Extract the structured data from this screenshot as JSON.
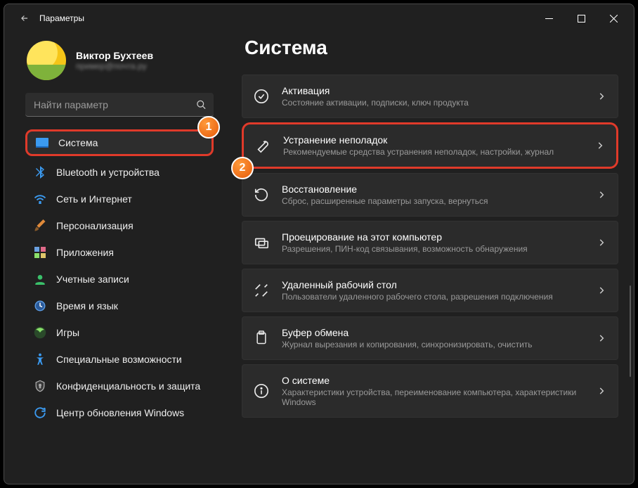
{
  "window": {
    "title": "Параметры"
  },
  "profile": {
    "name": "Виктор Бухтеев",
    "subtitle": "пример@почта.ру"
  },
  "search": {
    "placeholder": "Найти параметр"
  },
  "sidebar": {
    "items": [
      {
        "label": "Система"
      },
      {
        "label": "Bluetooth и устройства"
      },
      {
        "label": "Сеть и Интернет"
      },
      {
        "label": "Персонализация"
      },
      {
        "label": "Приложения"
      },
      {
        "label": "Учетные записи"
      },
      {
        "label": "Время и язык"
      },
      {
        "label": "Игры"
      },
      {
        "label": "Специальные возможности"
      },
      {
        "label": "Конфиденциальность и защита"
      },
      {
        "label": "Центр обновления Windows"
      }
    ]
  },
  "page": {
    "title": "Система"
  },
  "cards": [
    {
      "title": "Активация",
      "subtitle": "Состояние активации, подписки, ключ продукта"
    },
    {
      "title": "Устранение неполадок",
      "subtitle": "Рекомендуемые средства устранения неполадок, настройки, журнал"
    },
    {
      "title": "Восстановление",
      "subtitle": "Сброс, расширенные параметры запуска, вернуться"
    },
    {
      "title": "Проецирование на этот компьютер",
      "subtitle": "Разрешения, ПИН-код связывания, возможность обнаружения"
    },
    {
      "title": "Удаленный рабочий стол",
      "subtitle": "Пользователи удаленного рабочего стола, разрешения подключения"
    },
    {
      "title": "Буфер обмена",
      "subtitle": "Журнал вырезания и копирования, синхронизировать, очистить"
    },
    {
      "title": "О системе",
      "subtitle": "Характеристики устройства, переименование компьютера, характеристики Windows"
    }
  ],
  "callouts": {
    "one": "1",
    "two": "2"
  }
}
